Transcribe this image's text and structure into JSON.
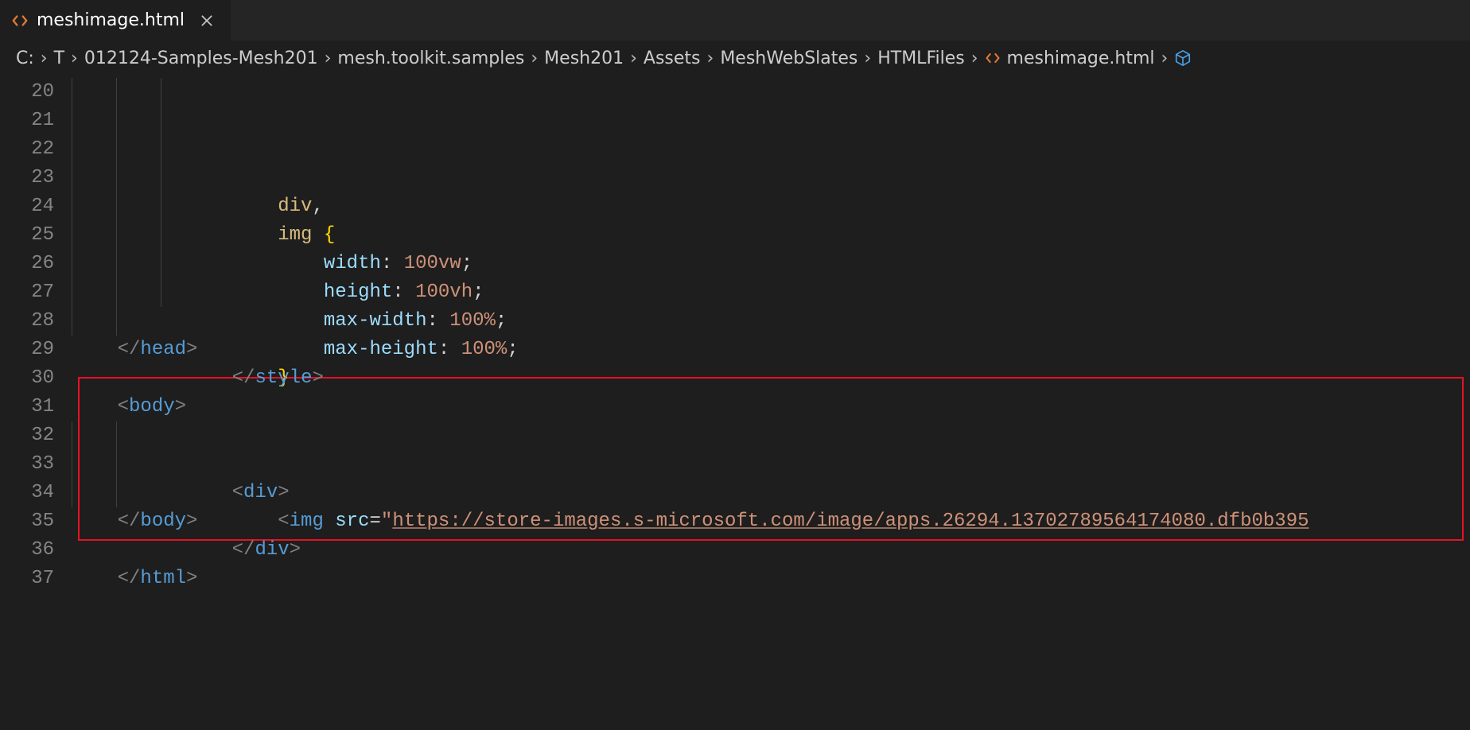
{
  "tab": {
    "filename": "meshimage.html",
    "file_ext_label": "<>"
  },
  "breadcrumbs": {
    "parts": [
      "C:",
      "T",
      "012124-Samples-Mesh201",
      "mesh.toolkit.samples",
      "Mesh201",
      "Assets",
      "MeshWebSlates",
      "HTMLFiles",
      "meshimage.html"
    ]
  },
  "line_numbers": [
    "20",
    "21",
    "22",
    "23",
    "24",
    "25",
    "26",
    "27",
    "28",
    "29",
    "30",
    "31",
    "32",
    "33",
    "34",
    "35",
    "36",
    "37"
  ],
  "code": {
    "l20": {
      "indent": 3
    },
    "l21": {
      "sel": "div",
      "comma": ","
    },
    "l22": {
      "sel": "img",
      "brace": "{"
    },
    "l23": {
      "prop": "width",
      "val": "100vw"
    },
    "l24": {
      "prop": "height",
      "val": "100vh"
    },
    "l25": {
      "prop": "max-width",
      "val": "100%"
    },
    "l26": {
      "prop": "max-height",
      "val": "100%"
    },
    "l27": {
      "brace": "}"
    },
    "l28": {
      "close_tag": "style"
    },
    "l29": {
      "close_tag": "head"
    },
    "l31": {
      "open_tag": "body"
    },
    "l32": {
      "open_tag": "div"
    },
    "l33": {
      "tag": "img",
      "attr": "src",
      "url": "https://store-images.s-microsoft.com/image/apps.26294.13702789564174080.dfb0b395"
    },
    "l34": {
      "close_tag": "div"
    },
    "l35": {
      "close_tag": "body"
    },
    "l37": {
      "close_tag": "html"
    }
  },
  "icons": {
    "html_angle_color": "#e37933",
    "close_x": "×",
    "chevron": "›",
    "outline_cube_color": "#4aa0e6"
  }
}
